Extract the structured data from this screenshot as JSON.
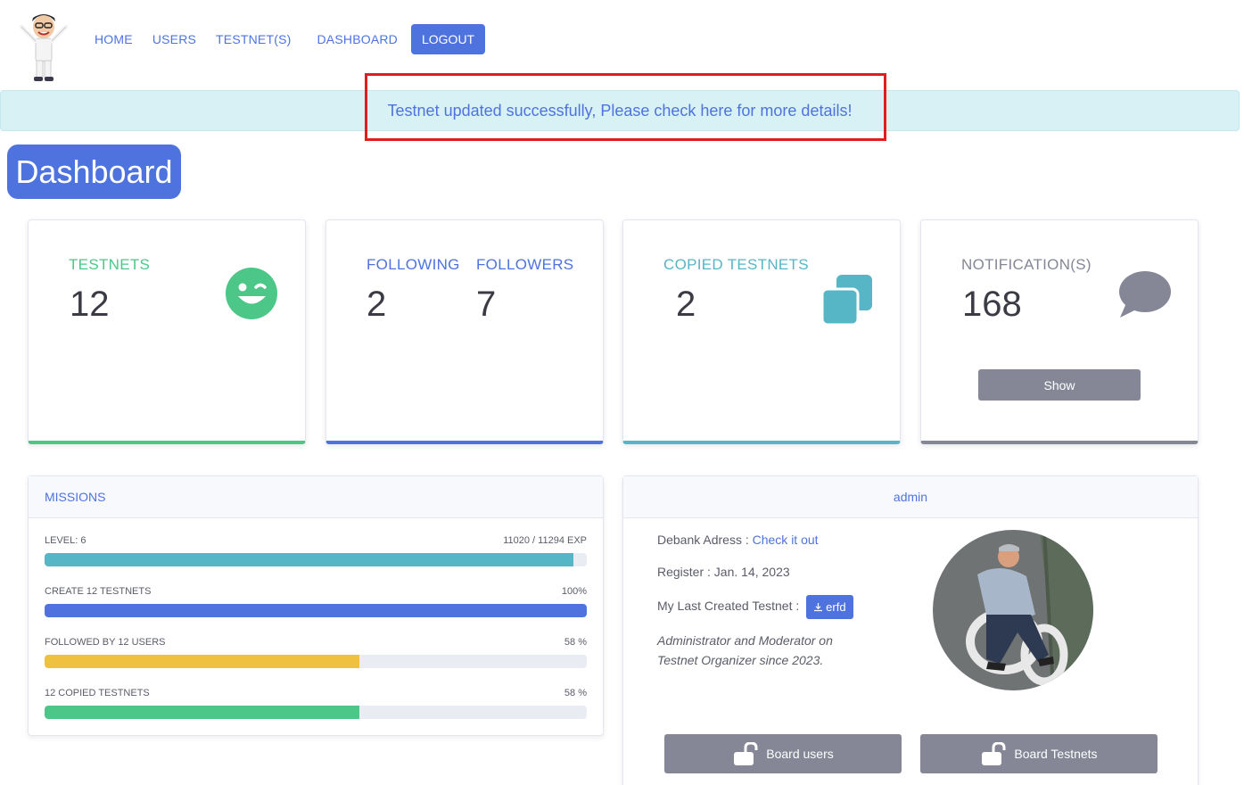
{
  "nav": {
    "items": [
      "HOME",
      "USERS",
      "TESTNET(S)",
      "DASHBOARD"
    ],
    "logout_label": "LOGOUT"
  },
  "alert": {
    "message": "Testnet updated successfully, Please check here for more details!"
  },
  "page_title": "Dashboard",
  "stats": {
    "testnets": {
      "label": "TESTNETS",
      "value": "12",
      "color": "#4dc788",
      "icon": "smiley-wink-icon"
    },
    "following": {
      "label": "FOLLOWING",
      "value": "2",
      "color": "#4e73df"
    },
    "followers": {
      "label": "FOLLOWERS",
      "value": "7",
      "color": "#4e73df"
    },
    "copied": {
      "label": "COPIED TESTNETS",
      "value": "2",
      "color": "#4db6c8",
      "icon": "copy-icon"
    },
    "notifications": {
      "label": "NOTIFICATION(S)",
      "value": "168",
      "color": "#858796",
      "icon": "comment-icon",
      "button": "Show"
    }
  },
  "missions": {
    "title": "MISSIONS",
    "items": [
      {
        "label": "LEVEL: 6",
        "value": "11020 / 11294 EXP",
        "progress": 0.976,
        "color": "#56b6c6"
      },
      {
        "label": "CREATE 12 TESTNETS",
        "value": "100%",
        "progress": 1.0,
        "color": "#4e73df"
      },
      {
        "label": "FOLLOWED BY 12 USERS",
        "value": "58 %",
        "progress": 0.58,
        "color": "#f0c040"
      },
      {
        "label": "12 COPIED TESTNETS",
        "value": "58 %",
        "progress": 0.58,
        "color": "#4dc788"
      }
    ]
  },
  "profile": {
    "username": "admin",
    "debank_label": "Debank Adress : ",
    "debank_link": "Check it out",
    "register": "Register : Jan. 14, 2023",
    "last_testnet_label": "My Last Created Testnet : ",
    "last_testnet_name": "erfd",
    "bio": "Administrator and Moderator on Testnet Organizer since 2023.",
    "board_users": "Board users",
    "board_testnets": "Board Testnets"
  }
}
